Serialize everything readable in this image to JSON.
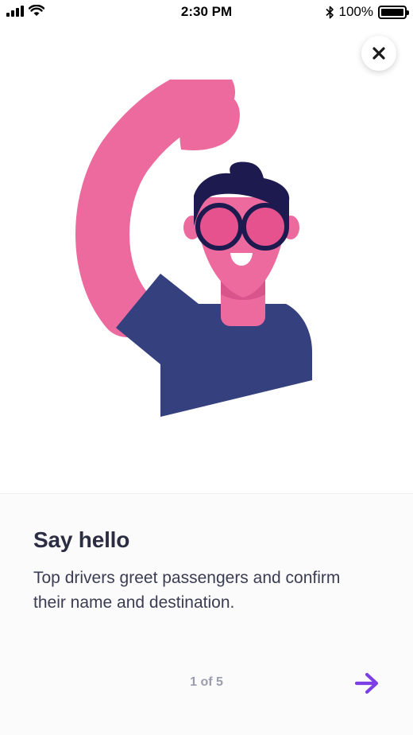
{
  "status_bar": {
    "time": "2:30 PM",
    "battery": "100%",
    "icons": [
      "signal-icon",
      "wifi-icon",
      "bluetooth-icon",
      "battery-icon"
    ]
  },
  "close_icon": "close-icon",
  "onboarding": {
    "title": "Say hello",
    "description": "Top drivers greet passengers and confirm their name and destination.",
    "pager": "1 of 5",
    "next_icon": "arrow-right-icon"
  },
  "colors": {
    "accent": "#7b3fe4",
    "illustration_pink": "#ec6a9e",
    "illustration_navy": "#35407e",
    "hair": "#1d1a4f",
    "title": "#2b2d42"
  }
}
